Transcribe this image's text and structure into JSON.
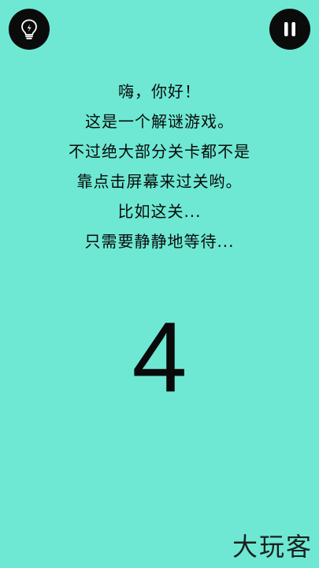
{
  "game": {
    "dialog_lines": [
      "嗨，你好！",
      "这是一个解谜游戏。",
      "不过绝大部分关卡都不是",
      "靠点击屏幕来过关哟。",
      "比如这关...",
      "只需要静静地等待..."
    ],
    "countdown": "4"
  },
  "buttons": {
    "hint_icon": "lightbulb-icon",
    "pause_icon": "pause-icon"
  },
  "watermark": {
    "text": "大玩客"
  },
  "colors": {
    "background": "#6ee8d3",
    "button": "#0b0b0b",
    "text": "#0a0a0a"
  }
}
